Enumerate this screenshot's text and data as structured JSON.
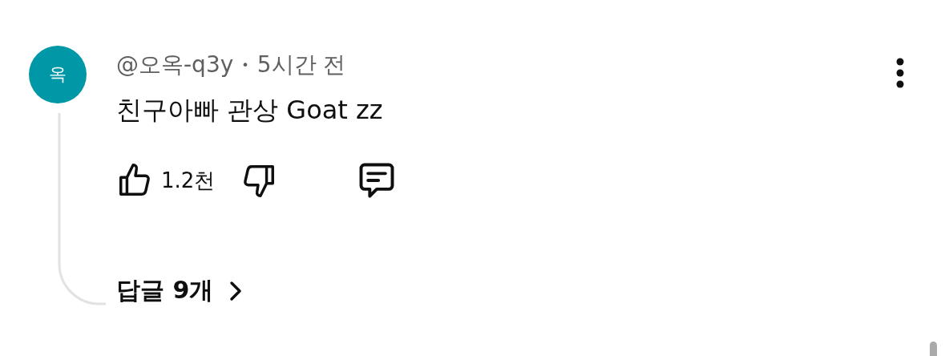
{
  "comment": {
    "avatar": {
      "letter": "옥",
      "color": "#0097a7"
    },
    "author": "@오옥-q3y",
    "separator": "•",
    "time": "5시간 전",
    "text": "친구아빠 관상 Goat zz",
    "likes": "1.2천",
    "replies": "답글 9개"
  }
}
